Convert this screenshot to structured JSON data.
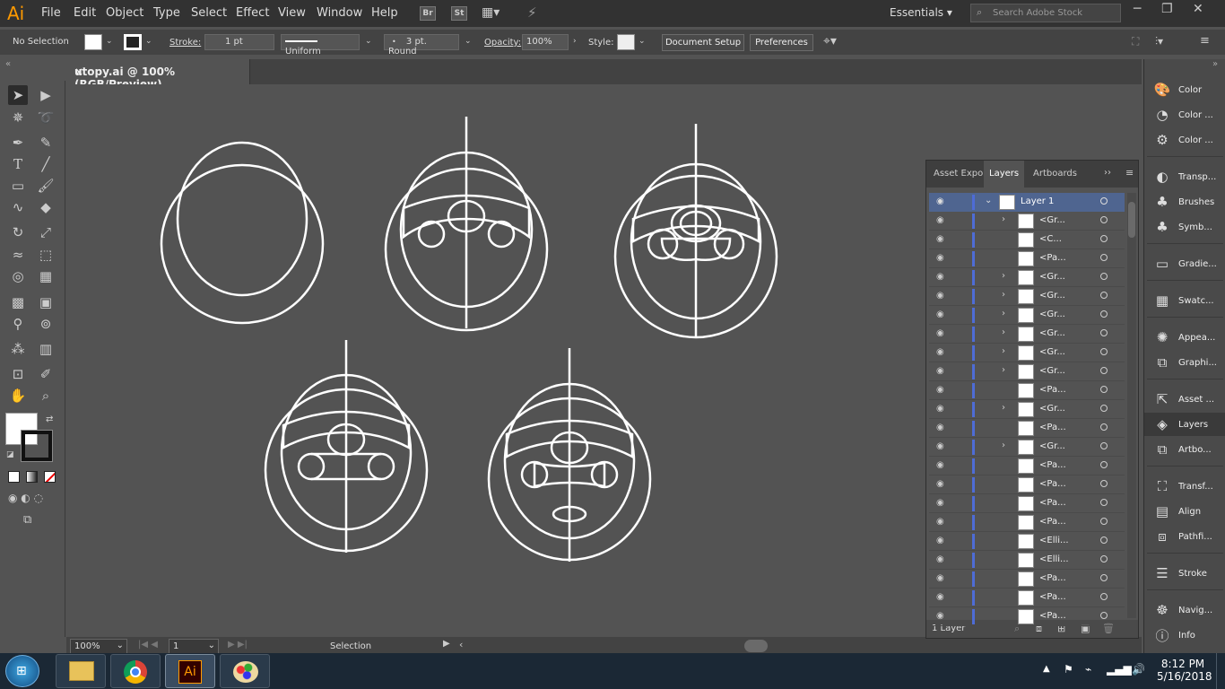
{
  "app": {
    "logo": "Ai",
    "bridge": "Br",
    "stock": "St",
    "workspace": "Essentials",
    "search_placeholder": "Search Adobe Stock"
  },
  "menu": [
    "File",
    "Edit",
    "Object",
    "Type",
    "Select",
    "Effect",
    "View",
    "Window",
    "Help"
  ],
  "control": {
    "selection": "No Selection",
    "stroke_label": "Stroke:",
    "stroke_value": "1 pt",
    "profile": "Uniform",
    "brush": "3 pt. Round",
    "opacity_label": "Opacity:",
    "opacity_value": "100%",
    "style_label": "Style:",
    "doc_setup": "Document Setup",
    "preferences": "Preferences"
  },
  "document": {
    "tab": "utopy.ai @ 100% (RGB/Preview)",
    "close": "×"
  },
  "status": {
    "zoom": "100%",
    "artboard": "1",
    "tool": "Selection"
  },
  "dock": [
    {
      "icon": "palette-icon",
      "label": "Color"
    },
    {
      "icon": "color-guide-icon",
      "label": "Color ..."
    },
    {
      "icon": "color-themes-icon",
      "label": "Color ..."
    },
    {
      "icon": "transparency-icon",
      "label": "Transp..."
    },
    {
      "icon": "brush-icon",
      "label": "Brushes"
    },
    {
      "icon": "symbols-icon",
      "label": "Symb..."
    },
    {
      "icon": "gradient-icon",
      "label": "Gradie..."
    },
    {
      "icon": "swatches-icon",
      "label": "Swatc..."
    },
    {
      "icon": "appearance-icon",
      "label": "Appea..."
    },
    {
      "icon": "graphic-styles-icon",
      "label": "Graphi..."
    },
    {
      "icon": "asset-export-icon",
      "label": "Asset ..."
    },
    {
      "icon": "layers-icon",
      "label": "Layers"
    },
    {
      "icon": "artboards-icon",
      "label": "Artbo..."
    },
    {
      "icon": "transform-icon",
      "label": "Transf..."
    },
    {
      "icon": "align-icon",
      "label": "Align"
    },
    {
      "icon": "pathfinder-icon",
      "label": "Pathfi..."
    },
    {
      "icon": "stroke-icon",
      "label": "Stroke"
    },
    {
      "icon": "navigator-icon",
      "label": "Navig..."
    },
    {
      "icon": "info-icon",
      "label": "Info"
    }
  ],
  "layers_panel": {
    "tabs": [
      "Asset Expor",
      "Layers",
      "Artboards"
    ],
    "layer_name": "Layer 1",
    "footer": "1 Layer",
    "items": [
      {
        "name": "<Gr...",
        "expand": true
      },
      {
        "name": "<C...",
        "expand": false
      },
      {
        "name": "<Pa...",
        "expand": false
      },
      {
        "name": "<Gr...",
        "expand": true
      },
      {
        "name": "<Gr...",
        "expand": true
      },
      {
        "name": "<Gr...",
        "expand": true
      },
      {
        "name": "<Gr...",
        "expand": true
      },
      {
        "name": "<Gr...",
        "expand": true
      },
      {
        "name": "<Gr...",
        "expand": true
      },
      {
        "name": "<Pa...",
        "expand": false
      },
      {
        "name": "<Gr...",
        "expand": true
      },
      {
        "name": "<Pa...",
        "expand": false
      },
      {
        "name": "<Gr...",
        "expand": true
      },
      {
        "name": "<Pa...",
        "expand": false
      },
      {
        "name": "<Pa...",
        "expand": false
      },
      {
        "name": "<Pa...",
        "expand": false
      },
      {
        "name": "<Pa...",
        "expand": false
      },
      {
        "name": "<Elli...",
        "expand": false
      },
      {
        "name": "<Elli...",
        "expand": false
      },
      {
        "name": "<Pa...",
        "expand": false
      },
      {
        "name": "<Pa...",
        "expand": false
      },
      {
        "name": "<Pa...",
        "expand": false
      }
    ]
  },
  "taskbar": {
    "time": "8:12 PM",
    "date": "5/16/2018",
    "ai_label": "Ai"
  }
}
